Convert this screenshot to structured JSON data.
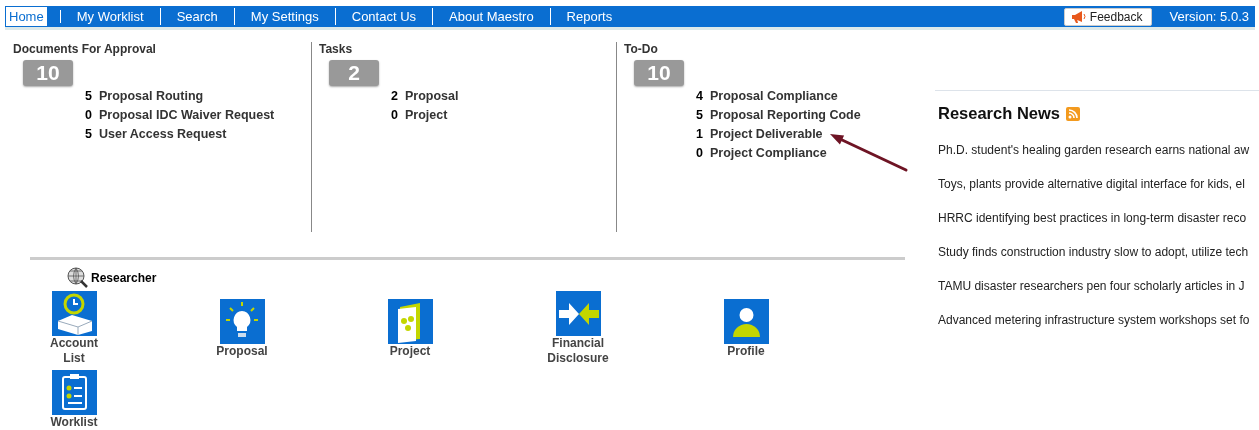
{
  "nav": {
    "items": [
      {
        "label": "Home",
        "selected": true
      },
      {
        "label": "My Worklist",
        "selected": false
      },
      {
        "label": "Search",
        "selected": false
      },
      {
        "label": "My Settings",
        "selected": false
      },
      {
        "label": "Contact Us",
        "selected": false
      },
      {
        "label": "About Maestro",
        "selected": false
      },
      {
        "label": "Reports",
        "selected": false
      }
    ],
    "feedback_button": "Feedback",
    "version": "Version: 5.0.3"
  },
  "summaries": [
    {
      "title": "Documents For Approval",
      "total": "10",
      "items": [
        {
          "count": "5",
          "label": "Proposal Routing"
        },
        {
          "count": "0",
          "label": "Proposal IDC Waiver Request"
        },
        {
          "count": "5",
          "label": "User Access Request"
        }
      ]
    },
    {
      "title": "Tasks",
      "total": "2",
      "items": [
        {
          "count": "2",
          "label": "Proposal"
        },
        {
          "count": "0",
          "label": "Project"
        }
      ]
    },
    {
      "title": "To-Do",
      "total": "10",
      "items": [
        {
          "count": "4",
          "label": "Proposal Compliance"
        },
        {
          "count": "5",
          "label": "Proposal Reporting Code"
        },
        {
          "count": "1",
          "label": "Project Deliverable"
        },
        {
          "count": "0",
          "label": "Project Compliance"
        }
      ]
    }
  ],
  "researcher": {
    "title": "Researcher",
    "apps": [
      {
        "label": "Account List"
      },
      {
        "label": "Proposal"
      },
      {
        "label": "Project"
      },
      {
        "label": "Financial Disclosure"
      },
      {
        "label": "Profile"
      },
      {
        "label": "Worklist"
      }
    ]
  },
  "news": {
    "title": "Research News",
    "items": [
      "Ph.D. student's healing garden research earns national aw",
      "Toys, plants provide alternative digital interface for kids, el",
      "HRRC identifying best practices in long-term disaster reco",
      "Study finds construction industry slow to adopt, utilize tech",
      "TAMU disaster researchers pen four scholarly articles in J",
      "Advanced metering infrastructure system workshops set fo"
    ]
  }
}
